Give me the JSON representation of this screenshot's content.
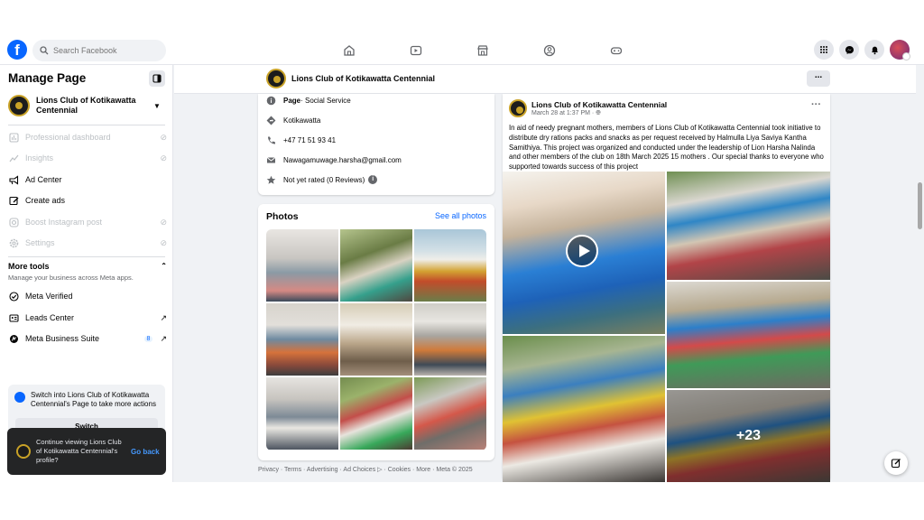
{
  "topnav": {
    "logo": "f",
    "search_placeholder": "Search Facebook",
    "center_icons": [
      "home-icon",
      "video-icon",
      "marketplace-icon",
      "groups-icon",
      "gaming-icon"
    ],
    "right_icons": [
      "menu-grid-icon",
      "messenger-icon",
      "notifications-icon",
      "profile-avatar"
    ]
  },
  "sidebar": {
    "title": "Manage Page",
    "page_name": "Lions Club of Kotikawatta Centennial",
    "items": [
      {
        "label": "Professional dashboard",
        "enabled": false
      },
      {
        "label": "Insights",
        "enabled": false
      },
      {
        "label": "Ad Center",
        "enabled": true
      },
      {
        "label": "Create ads",
        "enabled": true
      },
      {
        "label": "Boost Instagram post",
        "enabled": false
      },
      {
        "label": "Settings",
        "enabled": false
      }
    ],
    "more_tools": {
      "title": "More tools",
      "subtitle": "Manage your business across Meta apps.",
      "items": [
        {
          "label": "Meta Verified"
        },
        {
          "label": "Leads Center"
        },
        {
          "label": "Meta Business Suite",
          "badge": "8"
        }
      ]
    },
    "switch_box": {
      "text": "Switch into Lions Club of Kotikawatta Centennial's Page to take more actions",
      "button": "Switch"
    },
    "toast": {
      "text": "Continue viewing Lions Club of Kotikawatta Centennial's profile?",
      "action": "Go back"
    }
  },
  "page_header": {
    "name": "Lions Club of Kotikawatta Centennial",
    "more": "..."
  },
  "intro": {
    "category_label": "Page",
    "category_value": " · Social Service",
    "location": "Kotikawatta",
    "phone": "+47 71 51 93 41",
    "email": "Nawagamuwage.harsha@gmail.com",
    "rating": "Not yet rated (0 Reviews)"
  },
  "photos": {
    "title": "Photos",
    "see_all": "See all photos"
  },
  "footer": "Privacy · Terms · Advertising · Ad Choices ▷ · Cookies · More · Meta © 2025",
  "post": {
    "author": "Lions Club of Kotikawatta Centennial",
    "time": "March 28 at 1:37 PM · ",
    "text": "In aid of needy pregnant mothers, members of Lions Club of Kotikawatta Centennial took initiative to distribute dry rations packs and snacks as per request received by Halmulla Liya Saviya Kantha Samithiya. This project was organized and conducted under the leadership of Lion Harsha Nalinda and other members of the club on 18th March 2025 15 mothers .  Our special thanks to everyone who supported towards success of this project",
    "more_photos": "+23"
  },
  "colors": {
    "brand": "#0866ff",
    "background": "#f0f2f5",
    "toast": "#242526"
  }
}
